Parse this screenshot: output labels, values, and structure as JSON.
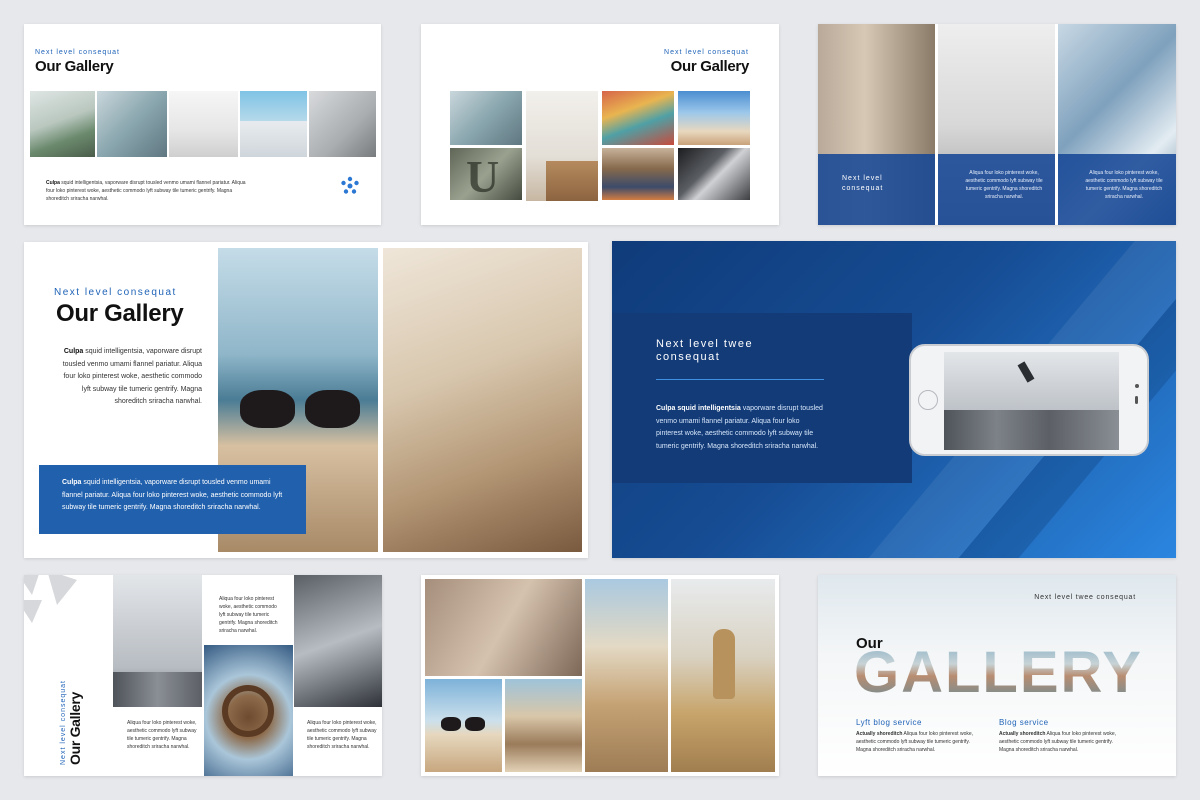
{
  "colors": {
    "accent": "#1f63b8",
    "navy": "#143a73",
    "blue_panel": "#2060ad",
    "background": "#e6e8ec"
  },
  "s1": {
    "kicker": "Next level consequat",
    "title": "Our Gallery",
    "body_bold": "Culpa",
    "body": "squid intelligentsia, vaporware disrupt tousled venmo umami flannel pariatur. Aliqua four loko pinterest woke, aesthetic commodo lyft subway tile tumeric gentrify. Magna shoreditch sriracha narwhal.",
    "logo_icon": "snowflake-logo-icon"
  },
  "s2": {
    "kicker": "Next level consequat",
    "title": "Our Gallery"
  },
  "s3": {
    "caption": "Next level consequat",
    "col2": "Aliqua four loko pinterest woke, aesthetic commodo lyft subway tile tumeric gentrify. Magna shoreditch sriracha narwhal.",
    "col3": "Aliqua four loko pinterest woke, aesthetic commodo lyft subway tile tumeric gentrify. Magna shoreditch sriracha narwhal."
  },
  "s4": {
    "kicker": "Next level consequat",
    "title": "Our Gallery",
    "body_bold": "Culpa",
    "body": "squid intelligentsia, vaporware disrupt tousled venmo umami flannel pariatur. Aliqua four loko pinterest woke, aesthetic commodo lyft subway tile tumeric gentrify. Magna shoreditch sriracha narwhal.",
    "box_bold": "Culpa",
    "box": "squid intelligentsia, vaporware disrupt tousled venmo umami flannel pariatur. Aliqua four loko pinterest woke, aesthetic commodo lyft subway tile tumeric gentrify. Magna shoreditch sriracha narwhal."
  },
  "s5": {
    "title": "Next level twee consequat",
    "body_bold": "Culpa squid intelligentsia",
    "body": "vaporware disrupt tousled venmo umami flannel pariatur. Aliqua four loko pinterest woke, aesthetic commodo lyft subway tile tumeric gentrify. Magna shoreditch sriracha narwhal."
  },
  "s6": {
    "kicker": "Next level consequat",
    "title": "Our Gallery",
    "text_a": "Aliqua four loko pinterest woke, aesthetic commodo lyft subway tile tumeric gentrify. Magna shoreditch sriracha narwhal.",
    "text_b": "Aliqua four loko pinterest woke, aesthetic commodo lyft subway tile tumeric gentrify. Magna shoreditch sriracha narwhal.",
    "text_c": "Aliqua four loko pinterest woke, aesthetic commodo lyft subway tile tumeric gentrify. Magna shoreditch sriracha narwhal."
  },
  "s8": {
    "kicker": "Next level twee consequat",
    "our": "Our",
    "gallery": "GALLERY",
    "col1_title": "Lyft blog service",
    "col1_bold": "Actually shoreditch",
    "col1": "Aliqua four loko pinterest woke, aesthetic commodo lyft subway tile tumeric gentrify. Magna shoreditch sriracha narwhal.",
    "col2_title": "Blog service",
    "col2_bold": "Actually shoreditch",
    "col2": "Aliqua four loko pinterest woke, aesthetic commodo lyft subway tile tumeric gentrify. Magna shoreditch sriracha narwhal."
  }
}
